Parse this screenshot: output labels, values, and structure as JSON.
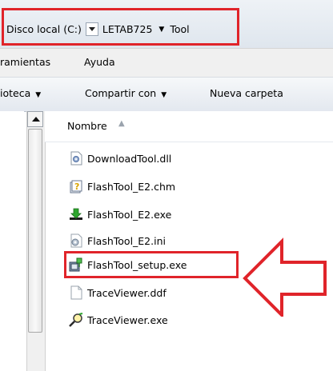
{
  "address_bar": {
    "segments": [
      "Disco local (C:)",
      "LETAB725",
      "Tool"
    ]
  },
  "menu": {
    "items": [
      "ramientas",
      "Ayuda"
    ]
  },
  "toolbar": {
    "library_label": "ioteca",
    "share_label": "Compartir con",
    "new_folder_label": "Nueva carpeta"
  },
  "column_header": {
    "name_label": "Nombre"
  },
  "files": [
    {
      "name": "DownloadTool.dll",
      "icon": "dll-icon"
    },
    {
      "name": "FlashTool_E2.chm",
      "icon": "help-file-icon"
    },
    {
      "name": "FlashTool_E2.exe",
      "icon": "green-download-arrow-icon"
    },
    {
      "name": "FlashTool_E2.ini",
      "icon": "ini-settings-icon"
    },
    {
      "name": "FlashTool_setup.exe",
      "icon": "installer-icon"
    },
    {
      "name": "TraceViewer.ddf",
      "icon": "blank-file-icon"
    },
    {
      "name": "TraceViewer.exe",
      "icon": "magnifier-tool-icon"
    }
  ],
  "annotations": {
    "highlight_color": "#e0242a"
  }
}
